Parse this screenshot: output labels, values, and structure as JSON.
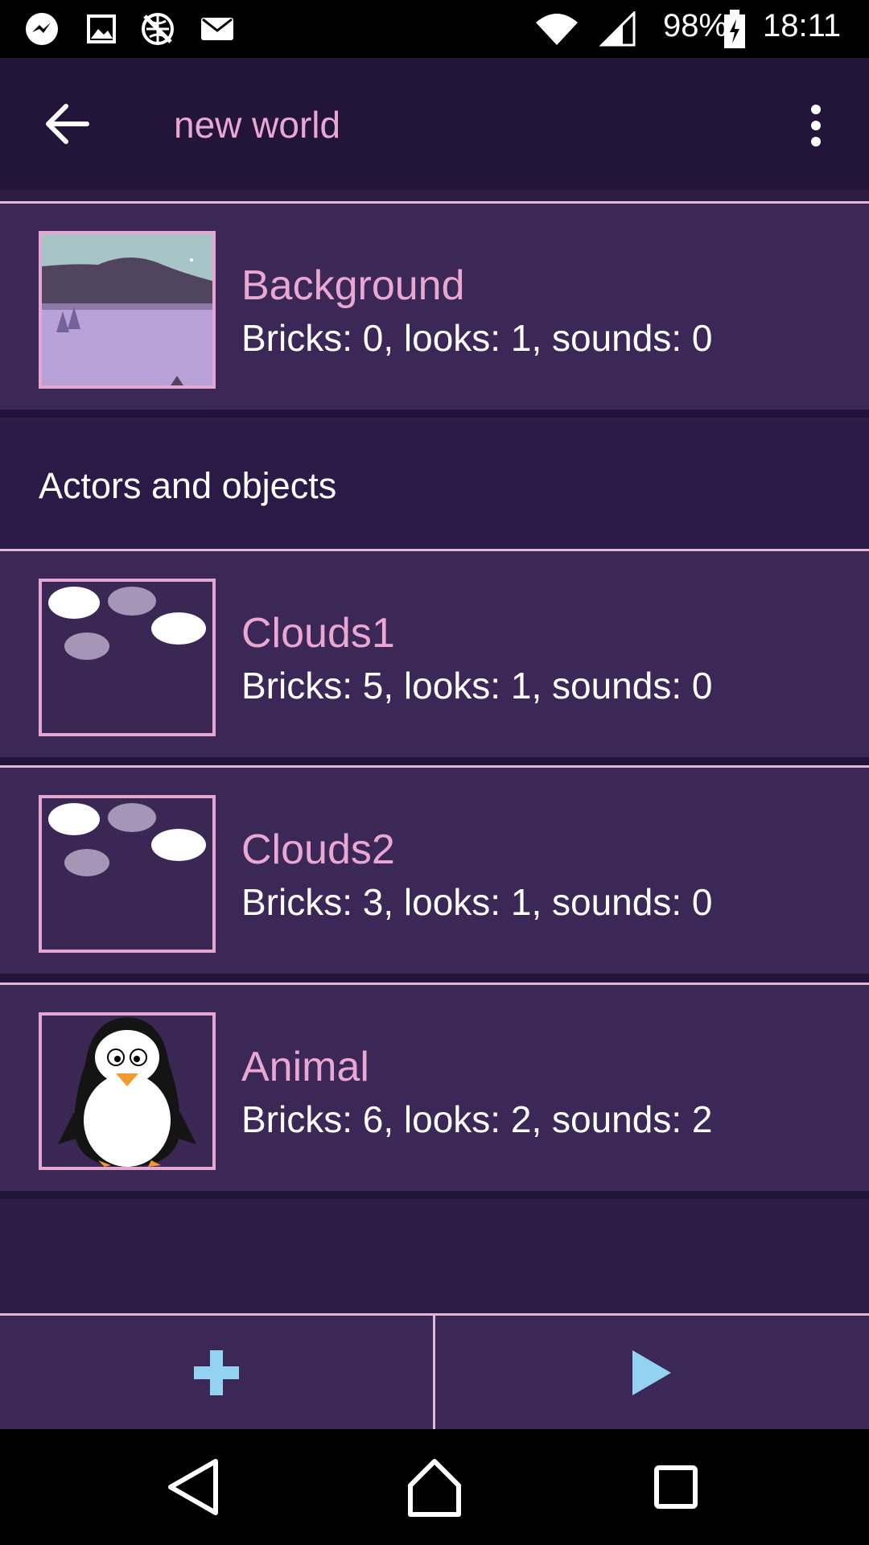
{
  "status_bar": {
    "battery": "98%",
    "time": "18:11",
    "icons": [
      "messenger-icon",
      "image-icon",
      "no-network-icon",
      "mail-icon",
      "wifi-icon",
      "signal-icon",
      "battery-charging-icon"
    ]
  },
  "app_bar": {
    "title": "new world",
    "back_icon": "arrow-left-icon",
    "menu_icon": "more-vert-icon"
  },
  "background": {
    "name": "Background",
    "details": "Bricks: 0, looks: 1, sounds: 0"
  },
  "section_header": "Actors and objects",
  "objects": [
    {
      "name": "Clouds1",
      "details": "Bricks: 5, looks: 1, sounds: 0",
      "thumb": "clouds"
    },
    {
      "name": "Clouds2",
      "details": "Bricks: 3, looks: 1, sounds: 0",
      "thumb": "clouds"
    },
    {
      "name": "Animal",
      "details": "Bricks: 6, looks: 2, sounds: 2",
      "thumb": "penguin"
    }
  ],
  "bottom_bar": {
    "add_icon": "plus-icon",
    "play_icon": "play-icon"
  },
  "nav_bar": {
    "icons": [
      "nav-back-icon",
      "nav-home-icon",
      "nav-recents-icon"
    ]
  },
  "colors": {
    "accent_pink": "#e9a7d2",
    "button_blue": "#93d3f1",
    "list_bg": "#3b2857",
    "page_bg": "#2c1c46"
  }
}
